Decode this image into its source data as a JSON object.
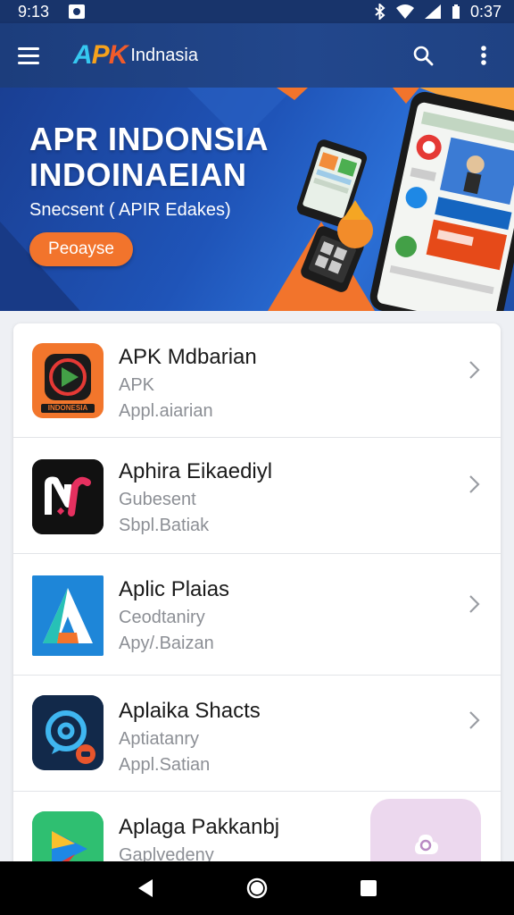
{
  "status_bar": {
    "time_left": "9:13",
    "time_right": "0:37"
  },
  "app_bar": {
    "logo": "APK",
    "title": "Indnasia",
    "icons": [
      "menu-icon",
      "search-icon",
      "more-vert-icon"
    ]
  },
  "hero": {
    "title_line1": "APR INDONSIA",
    "title_line2": "INDOINAEIAN",
    "subtitle": "Snecsent ( APIR Edakes)",
    "cta_label": "Peoayse",
    "colors": {
      "background": "#1f54b8",
      "accent": "#f2742c"
    }
  },
  "apps": [
    {
      "name": "APK Mdbarian",
      "line2": "APK",
      "line3": "Appl.aiarian",
      "icon_label": "INDONESIA",
      "icon": "play-icon"
    },
    {
      "name": "Aphira Eikaediyl",
      "line2": "Gubesent",
      "line3": "Sbpl.Batiak",
      "icon": "n-logo-icon"
    },
    {
      "name": "Aplic Plaias",
      "line2": "Ceodtaniry",
      "line3": "Apy/.Baizan",
      "icon": "a-logo-icon"
    },
    {
      "name": "Aplaika Shacts",
      "line2": "Aptiatanry",
      "line3": "Appl.Satian",
      "icon": "chat-bubble-icon"
    },
    {
      "name": "Aplaga Pakkanbj",
      "line2": "Gaplvedeny",
      "icon": "play-store-icon"
    }
  ],
  "nav_bar": {
    "icons": [
      "back-icon",
      "home-icon",
      "recents-icon"
    ]
  }
}
